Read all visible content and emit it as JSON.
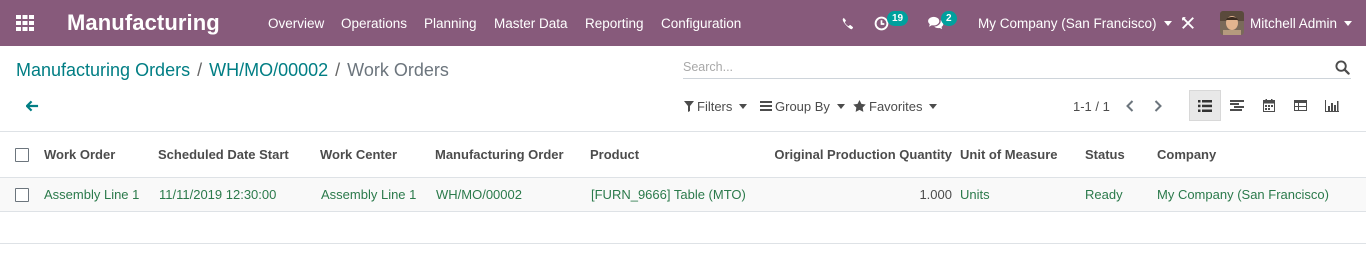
{
  "navbar": {
    "app_title": "Manufacturing",
    "menu": [
      "Overview",
      "Operations",
      "Planning",
      "Master Data",
      "Reporting",
      "Configuration"
    ],
    "activity_count": "19",
    "messages_count": "2",
    "company": "My Company (San Francisco)",
    "user": "Mitchell Admin"
  },
  "breadcrumb": {
    "items": [
      "Manufacturing Orders",
      "WH/MO/00002"
    ],
    "separator": "/",
    "current": "Work Orders"
  },
  "search": {
    "placeholder": "Search..."
  },
  "filters": {
    "filters_label": "Filters",
    "group_by_label": "Group By",
    "favorites_label": "Favorites"
  },
  "pager": {
    "value": "1-1 / 1"
  },
  "views": [
    "list-view-icon",
    "gantt-view-icon",
    "calendar-view-icon",
    "pivot-view-icon",
    "graph-view-icon"
  ],
  "colors": {
    "navbar": "#875a7b",
    "link": "#017e84",
    "row_text": "#2b7a4b",
    "badge": "#00a09d"
  },
  "table": {
    "columns": [
      "Work Order",
      "Scheduled Date Start",
      "Work Center",
      "Manufacturing Order",
      "Product",
      "Original Production Quantity",
      "Unit of Measure",
      "Status",
      "Company"
    ],
    "rows": [
      [
        "Assembly Line 1",
        "11/11/2019 12:30:00",
        "Assembly Line 1",
        "WH/MO/00002",
        "[FURN_9666] Table (MTO)",
        "1.000",
        "Units",
        "Ready",
        "My Company (San Francisco)"
      ]
    ]
  }
}
